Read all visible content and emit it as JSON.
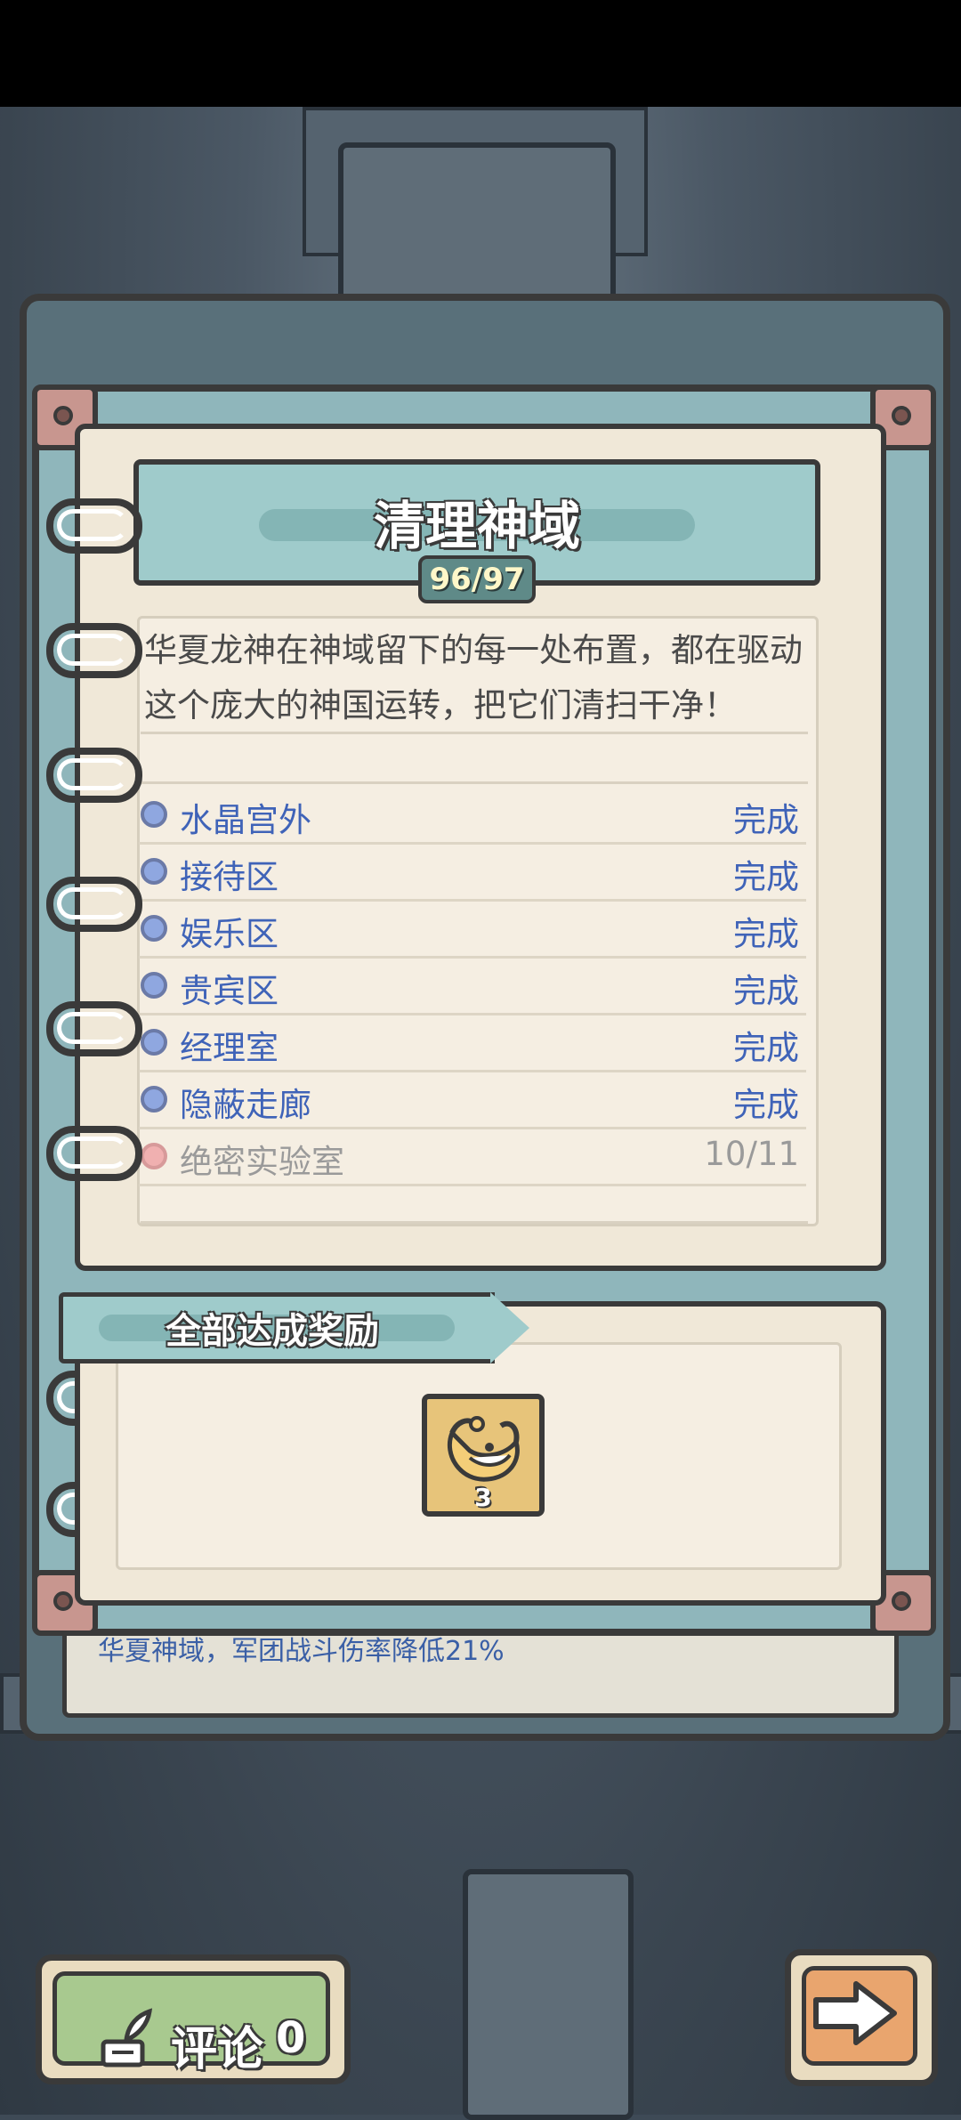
{
  "quest": {
    "title": "清理神域",
    "progress": "96/97",
    "description": "华夏龙神在神域留下的每一处布置，都在驱动这个庞大的神国运转，把它们清扫干净！",
    "areas": [
      {
        "name": "水晶宫外",
        "status": "完成",
        "done": true
      },
      {
        "name": "接待区",
        "status": "完成",
        "done": true
      },
      {
        "name": "娱乐区",
        "status": "完成",
        "done": true
      },
      {
        "name": "贵宾区",
        "status": "完成",
        "done": true
      },
      {
        "name": "经理室",
        "status": "完成",
        "done": true
      },
      {
        "name": "隐蔽走廊",
        "status": "完成",
        "done": true
      },
      {
        "name": "绝密实验室",
        "status": "10/11",
        "done": false
      }
    ]
  },
  "reward": {
    "label": "全部达成奖励",
    "item_icon": "horn-trophy-icon",
    "item_count": "3"
  },
  "back_page": {
    "text": "华夏神域，军团战斗伤率降低21%"
  },
  "bottom": {
    "comment_label": "评论",
    "comment_count": "0",
    "next_icon": "arrow-right-icon"
  },
  "colors": {
    "done_text": "#3f63b8",
    "pending_text": "#9a9a9a",
    "banner": "#9fcbcb",
    "paper": "#f0e8d8"
  }
}
